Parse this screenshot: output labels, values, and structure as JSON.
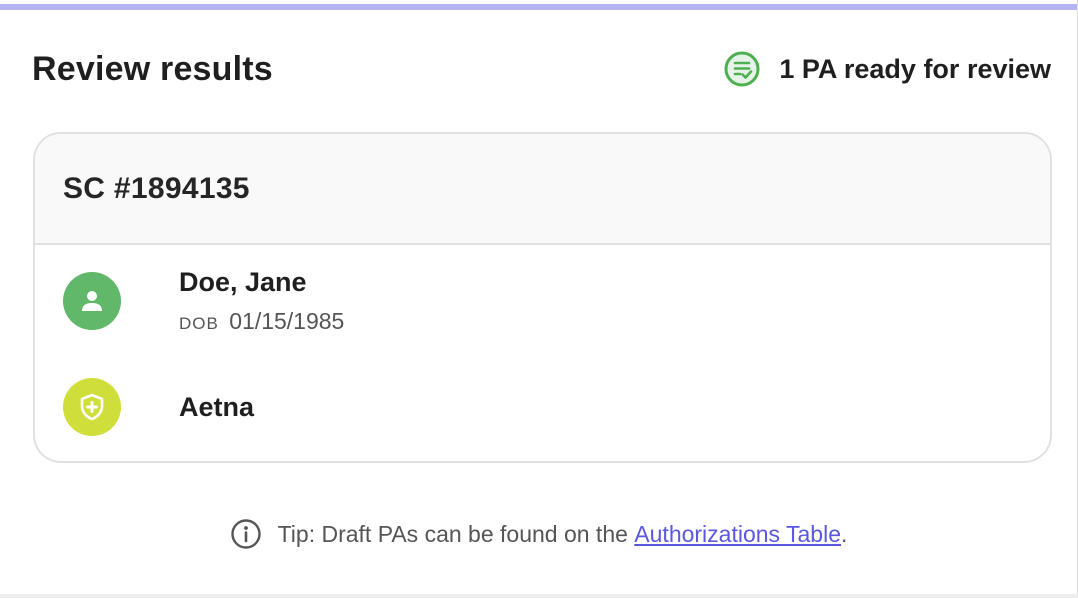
{
  "header": {
    "title": "Review results",
    "status_icon": "checklist-check-icon",
    "status_text": "1 PA ready for review"
  },
  "card": {
    "case_id": "SC #1894135",
    "patient": {
      "icon": "person-icon",
      "name": "Doe, Jane",
      "dob_label": "DOB",
      "dob_value": "01/15/1985"
    },
    "payer": {
      "icon": "shield-plus-icon",
      "name": "Aetna"
    }
  },
  "tip": {
    "icon": "info-icon",
    "text": "Tip: Draft PAs can be found on the ",
    "link_text": "Authorizations Table",
    "trailing": "."
  },
  "colors": {
    "accent_bar": "#b6b3f2",
    "status_green": "#4caf50",
    "patient_circle": "#62b86a",
    "payer_circle": "#cfde3a",
    "link": "#5b57e0"
  }
}
